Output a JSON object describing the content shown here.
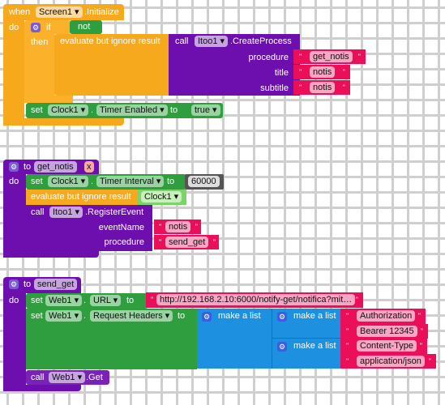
{
  "b1": {
    "when": "when",
    "component": "Screen1",
    "event": ".Initialize",
    "do": "do",
    "if": "if",
    "not": "not",
    "then": "then",
    "evaluate": "evaluate but ignore result",
    "call": "call",
    "itoo": "Itoo1",
    "method": ".CreateProcess",
    "procedure_label": "procedure",
    "procedure": "get_notis",
    "title_label": "title",
    "title": "notis",
    "subtitle_label": "subtitle",
    "subtitle": "notis",
    "set": "set",
    "clock": "Clock1",
    "dot": ".",
    "prop": "Timer Enabled",
    "to": "to",
    "value": "true"
  },
  "b2": {
    "to": "to",
    "name": "get_notis",
    "do": "do",
    "set": "set",
    "clock": "Clock1",
    "dot": ".",
    "prop": "Timer Interval",
    "to2": "to",
    "interval": "60000",
    "evaluate": "evaluate but ignore result",
    "clock2": "Clock1",
    "call": "call",
    "itoo": "Itoo1",
    "method": ".RegisterEvent",
    "event_label": "eventName",
    "event": "notis",
    "procedure_label": "procedure",
    "procedure": "send_get"
  },
  "b3": {
    "to": "to",
    "name": "send_get",
    "do": "do",
    "set": "set",
    "web": "Web1",
    "dot": ".",
    "url_prop": "URL",
    "to2": "to",
    "url": "http://192.168.2.10:6000/notify-get/notifica?mit…",
    "headers_prop": "Request Headers",
    "make_list": "make a list",
    "h1": "Authorization",
    "h2": "Bearer 12345",
    "h3": "Content-Type",
    "h4": "application/json",
    "call": "call",
    "get": ".Get"
  },
  "colors": {
    "control": "#f6a91c",
    "component_set": "#2f9e3e",
    "procedure": "#6d0eae",
    "text": "#eb0f5a",
    "list": "#1e90e0"
  }
}
